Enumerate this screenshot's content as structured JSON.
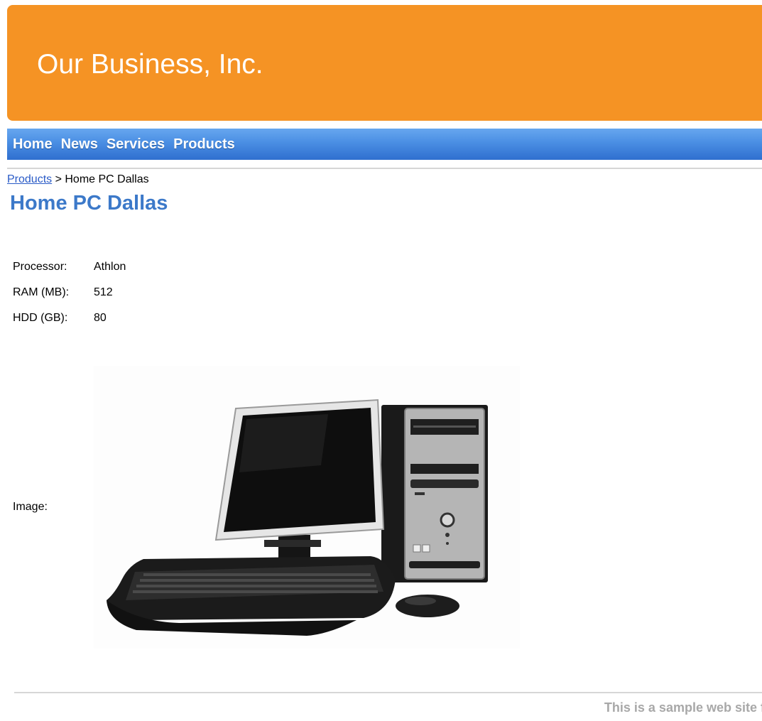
{
  "header": {
    "site_title": "Our Business, Inc."
  },
  "nav": {
    "items": [
      {
        "label": "Home"
      },
      {
        "label": "News"
      },
      {
        "label": "Services"
      },
      {
        "label": "Products"
      }
    ]
  },
  "breadcrumb": {
    "link_label": "Products",
    "separator": " > ",
    "current": "Home PC Dallas"
  },
  "product": {
    "title": "Home PC Dallas",
    "properties": [
      {
        "label": "Processor:",
        "value": "Athlon"
      },
      {
        "label": "RAM (MB):",
        "value": "512"
      },
      {
        "label": "HDD (GB):",
        "value": "80"
      }
    ],
    "image_label": "Image:",
    "image_icon": "desktop-computer-photo"
  },
  "footer": {
    "text": "This is a sample web site f"
  },
  "colors": {
    "banner": "#f59324",
    "nav_top": "#67a7ef",
    "nav_bottom": "#2f6fcf",
    "title": "#3c79c9",
    "link": "#2a5bc7",
    "footer_text": "#a8a8a8"
  }
}
